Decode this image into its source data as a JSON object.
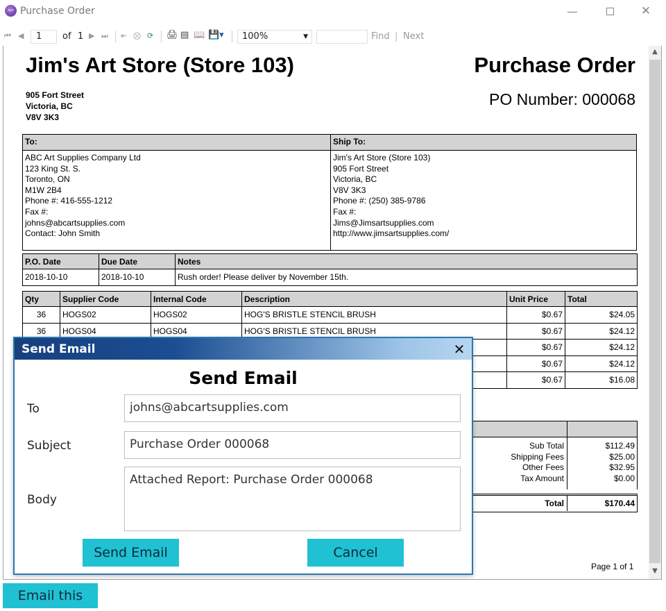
{
  "window": {
    "title": "Purchase Order",
    "app_icon_text": "sys"
  },
  "toolbar": {
    "page_current": "1",
    "page_of": "of",
    "page_total": "1",
    "zoom": "100%",
    "find_label": "Find",
    "find_sep": "|",
    "next_label": "Next"
  },
  "report": {
    "store_name": "Jim's Art Store (Store 103)",
    "doc_title": "Purchase Order",
    "store_address": [
      "905 Fort Street",
      "Victoria, BC",
      "V8V 3K3"
    ],
    "po_number": "PO Number: 000068",
    "to_header": "To:",
    "ship_header": "Ship To:",
    "to_lines": [
      "ABC Art Supplies Company Ltd",
      "123 King St. S.",
      "Toronto, ON",
      "M1W 2B4",
      "Phone #: 416-555-1212",
      "Fax #:",
      "johns@abcartsupplies.com",
      "Contact: John Smith"
    ],
    "ship_lines": [
      "Jim's Art Store (Store 103)",
      "905 Fort Street",
      "Victoria, BC",
      "V8V 3K3",
      "Phone #: (250) 385-9786",
      "Fax #:",
      "Jims@Jimsartsupplies.com",
      "http://www.jimsartsupplies.com/"
    ],
    "po_date_header": "P.O. Date",
    "due_date_header": "Due Date",
    "notes_header": "Notes",
    "po_date": "2018-10-10",
    "due_date": "2018-10-10",
    "notes": "Rush order! Please deliver by November 15th.",
    "columns": {
      "qty": "Qty",
      "supplier_code": "Supplier Code",
      "internal_code": "Internal Code",
      "description": "Description",
      "unit_price": "Unit Price",
      "total": "Total"
    },
    "items": [
      {
        "qty": "36",
        "supplier_code": "HOGS02",
        "internal_code": "HOGS02",
        "description": "HOG'S BRISTLE STENCIL BRUSH",
        "unit_price": "$0.67",
        "total": "$24.05"
      },
      {
        "qty": "36",
        "supplier_code": "HOGS04",
        "internal_code": "HOGS04",
        "description": "HOG'S BRISTLE STENCIL BRUSH",
        "unit_price": "$0.67",
        "total": "$24.12"
      },
      {
        "qty": "",
        "supplier_code": "",
        "internal_code": "",
        "description": "",
        "unit_price": "$0.67",
        "total": "$24.12"
      },
      {
        "qty": "",
        "supplier_code": "",
        "internal_code": "",
        "description": "",
        "unit_price": "$0.67",
        "total": "$24.12"
      },
      {
        "qty": "",
        "supplier_code": "",
        "internal_code": "",
        "description": "",
        "unit_price": "$0.67",
        "total": "$16.08"
      }
    ],
    "totals": {
      "sub_total_label": "Sub Total",
      "sub_total": "$112.49",
      "shipping_label": "Shipping Fees",
      "shipping": "$25.00",
      "other_label": "Other Fees",
      "other": "$32.95",
      "tax_label": "Tax Amount",
      "tax": "$0.00",
      "total_label": "Total",
      "total": "$170.44"
    },
    "page_footer": "Page 1 of 1"
  },
  "dialog": {
    "title": "Send Email",
    "heading": "Send Email",
    "to_label": "To",
    "to_value": "johns@abcartsupplies.com",
    "subject_label": "Subject",
    "subject_value": "Purchase Order 000068",
    "body_label": "Body",
    "body_value": "Attached Report: Purchase Order 000068",
    "send_button": "Send Email",
    "cancel_button": "Cancel"
  },
  "email_this_button": "Email this",
  "colors": {
    "accent_button": "#1fc1d3",
    "dialog_title_start": "#16407f",
    "dialog_title_end": "#b7d5f0",
    "header_gray": "#d3d3d3"
  }
}
